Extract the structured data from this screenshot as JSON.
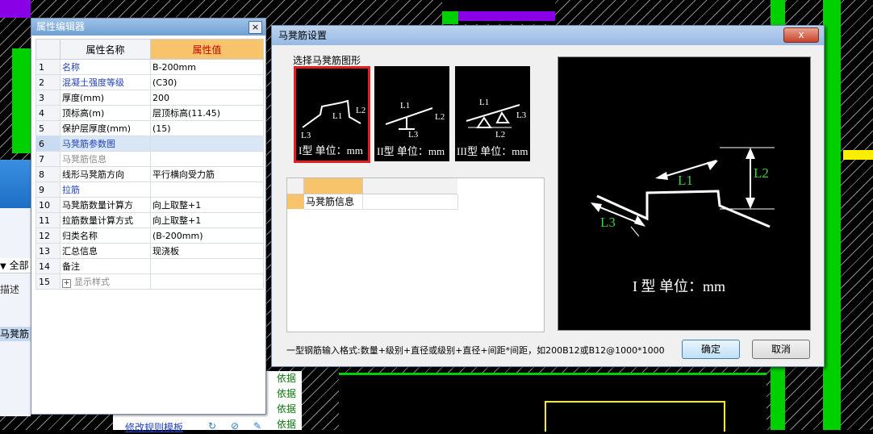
{
  "property_editor": {
    "title": "属性编辑器",
    "close_label": "×",
    "header_name": "属性名称",
    "header_value": "属性值",
    "rows": [
      {
        "n": "1",
        "name": "名称",
        "value": "B-200mm"
      },
      {
        "n": "2",
        "name": "混凝土强度等级",
        "value": "(C30)"
      },
      {
        "n": "3",
        "name": "厚度(mm)",
        "value": "200"
      },
      {
        "n": "4",
        "name": "顶标高(m)",
        "value": "层顶标高(11.45)"
      },
      {
        "n": "5",
        "name": "保护层厚度(mm)",
        "value": "(15)"
      },
      {
        "n": "6",
        "name": "马凳筋参数图",
        "value": ""
      },
      {
        "n": "7",
        "name": "马凳筋信息",
        "value": ""
      },
      {
        "n": "8",
        "name": "线形马凳筋方向",
        "value": "平行横向受力筋"
      },
      {
        "n": "9",
        "name": "拉筋",
        "value": ""
      },
      {
        "n": "10",
        "name": "马凳筋数量计算方",
        "value": "向上取整+1"
      },
      {
        "n": "11",
        "name": "拉筋数量计算方式",
        "value": "向上取整+1"
      },
      {
        "n": "12",
        "name": "归类名称",
        "value": "(B-200mm)"
      },
      {
        "n": "13",
        "name": "汇总信息",
        "value": "现浇板"
      },
      {
        "n": "14",
        "name": "备注",
        "value": ""
      },
      {
        "n": "15",
        "name": "显示样式",
        "value": ""
      }
    ],
    "expand_symbol": "+"
  },
  "underlay": {
    "dropdown_text": "全部",
    "label_desc": "描述",
    "tree_item": "马凳筋",
    "basis": [
      "依据",
      "依据",
      "依据",
      "依据"
    ],
    "link_text": "修改规则模板"
  },
  "dialog": {
    "title": "马凳筋设置",
    "close_label": "x",
    "section_label": "选择马凳筋图形",
    "shapes": [
      {
        "caption": "I型 单位：mm",
        "l1": "L1",
        "l2": "L2",
        "l3": "L3"
      },
      {
        "caption": "II型 单位：mm",
        "l1": "L1",
        "l2": "L2",
        "l3": "L3"
      },
      {
        "caption": "III型 单位：mm",
        "l1": "L1",
        "l2": "L2",
        "l3": "L3"
      }
    ],
    "grid_row_label": "马凳筋信息",
    "preview": {
      "caption": "I 型 单位：mm",
      "l1": "L1",
      "l2": "L2",
      "l3": "L3"
    },
    "hint": "一型钢筋输入格式:数量+级别+直径或级别+直径+间距*间距，如200B12或B12@1000*1000",
    "ok_label": "确定",
    "cancel_label": "取消"
  },
  "colors": {
    "accent_green": "#00e000",
    "accent_purple": "#8a00e6",
    "cad_yellow": "#ffee00",
    "label_green": "#3cd23c"
  }
}
